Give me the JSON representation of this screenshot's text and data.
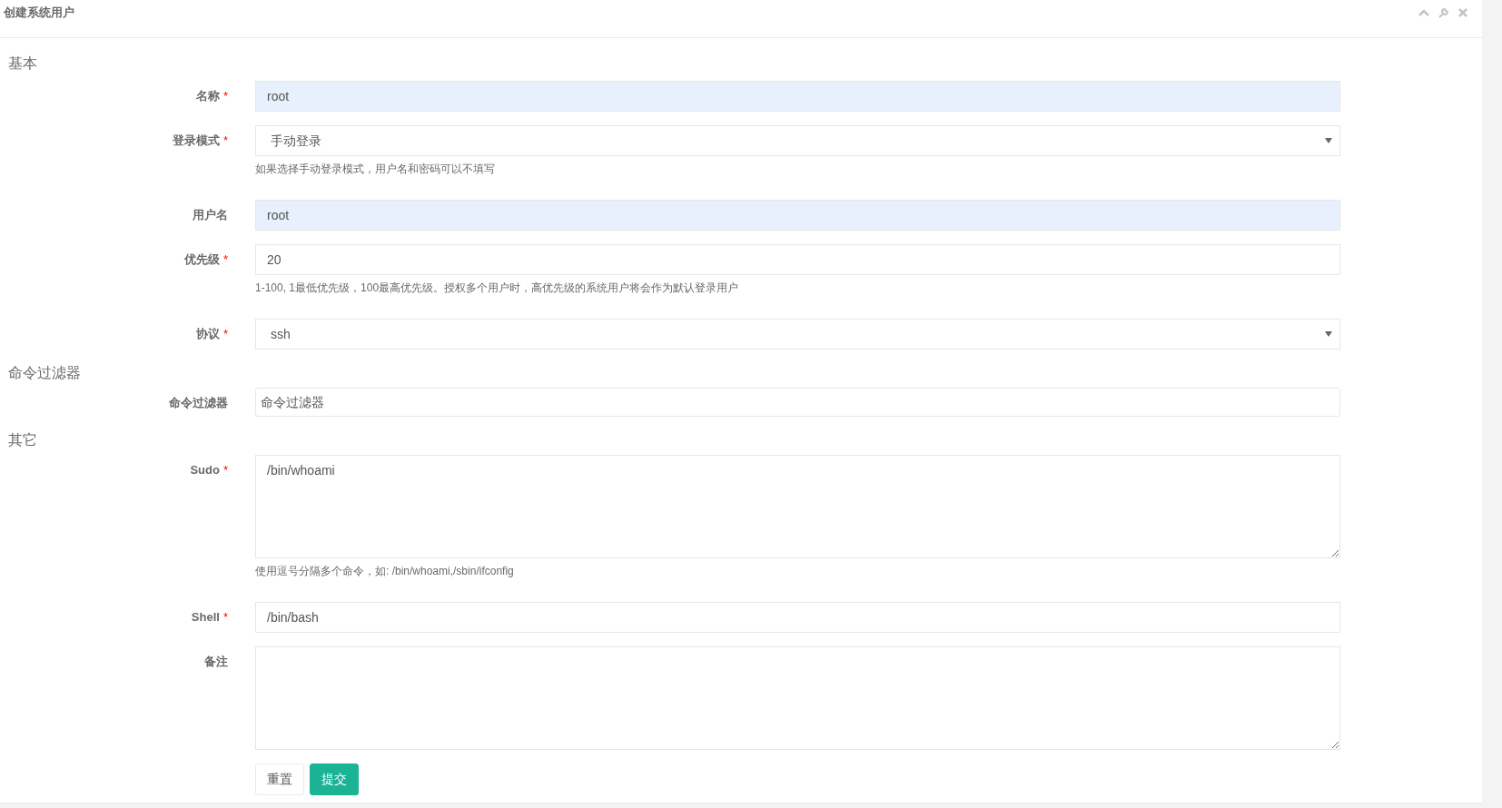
{
  "title": "创建系统用户",
  "sections": [
    {
      "title": "基本",
      "fields": [
        {
          "label": "名称",
          "mark": "*",
          "kind": "input",
          "value": "root",
          "autofilled": true
        },
        {
          "label": "登录模式",
          "mark": "*",
          "kind": "select",
          "value": "手动登录",
          "autofilled": false,
          "help": "如果选择手动登录模式，用户名和密码可以不填写"
        },
        {
          "label": "用户名",
          "kind": "input",
          "value": "root",
          "autofilled": true
        },
        {
          "label": "优先级",
          "mark": "*",
          "kind": "input",
          "value": "20",
          "autofilled": false,
          "help": "1-100, 1最低优先级，100最高优先级。授权多个用户时，高优先级的系统用户将会作为默认登录用户"
        },
        {
          "label": "协议",
          "mark": "*",
          "kind": "select",
          "value": "ssh",
          "autofilled": false
        }
      ]
    },
    {
      "title": "命令过滤器",
      "fields": [
        {
          "label": "命令过滤器",
          "kind": "multiselect",
          "placeholder": "命令过滤器",
          "autofilled": false
        }
      ]
    },
    {
      "title": "其它",
      "fields": [
        {
          "label": "Sudo",
          "mark": "*",
          "kind": "textarea",
          "value": "/bin/whoami",
          "autofilled": false,
          "help": "使用逗号分隔多个命令，如: /bin/whoami,/sbin/ifconfig"
        },
        {
          "label": "Shell",
          "mark": "*",
          "kind": "input",
          "value": "/bin/bash",
          "autofilled": false
        },
        {
          "label": "备注",
          "kind": "textarea",
          "autofilled": false
        }
      ]
    }
  ],
  "buttons": [
    {
      "label": "重置",
      "kind": "default"
    },
    {
      "label": "提交",
      "kind": "primary"
    }
  ]
}
